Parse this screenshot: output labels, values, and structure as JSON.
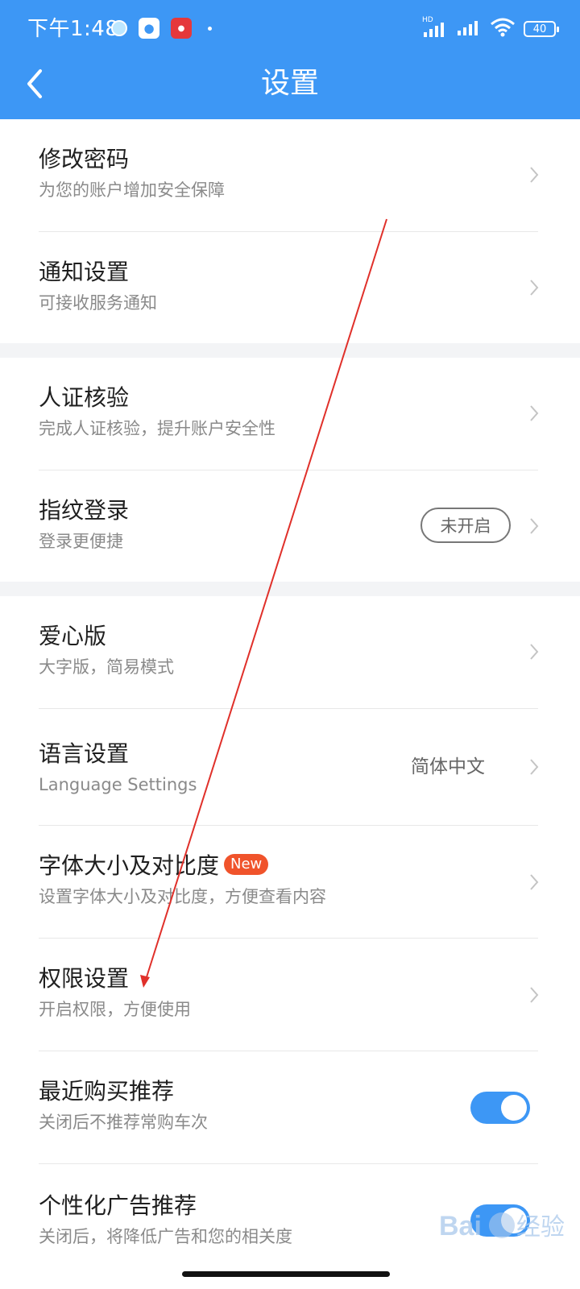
{
  "status_bar": {
    "time": "下午1:48",
    "network": "HD",
    "battery": "40"
  },
  "header": {
    "title": "设置",
    "back_icon": "chevron-left-icon"
  },
  "rows": [
    {
      "title": "修改密码",
      "subtitle": "为您的账户增加安全保障"
    },
    {
      "title": "通知设置",
      "subtitle": "可接收服务通知"
    },
    {
      "title": "人证核验",
      "subtitle": "完成人证核验，提升账户安全性"
    },
    {
      "title": "指纹登录",
      "subtitle": "登录更便捷",
      "status": "未开启"
    },
    {
      "title": "爱心版",
      "subtitle": "大字版，简易模式"
    },
    {
      "title": "语言设置",
      "subtitle": "Language Settings",
      "value": "简体中文"
    },
    {
      "title": "字体大小及对比度",
      "badge": "New",
      "subtitle": "设置字体大小及对比度，方便查看内容"
    },
    {
      "title": "权限设置",
      "subtitle": "开启权限，方便使用"
    },
    {
      "title": "最近购买推荐",
      "subtitle": "关闭后不推荐常购车次",
      "toggle_on": true
    },
    {
      "title": "个性化广告推荐",
      "subtitle": "关闭后，将降低广告和您的相关度",
      "toggle_on": true
    }
  ],
  "watermark": {
    "brand": "Bai 经验",
    "url": "jingyan.baidu.com"
  },
  "colors": {
    "accent": "#3d97f5",
    "badge": "#f0532b",
    "annotation_arrow": "#e0302a"
  }
}
